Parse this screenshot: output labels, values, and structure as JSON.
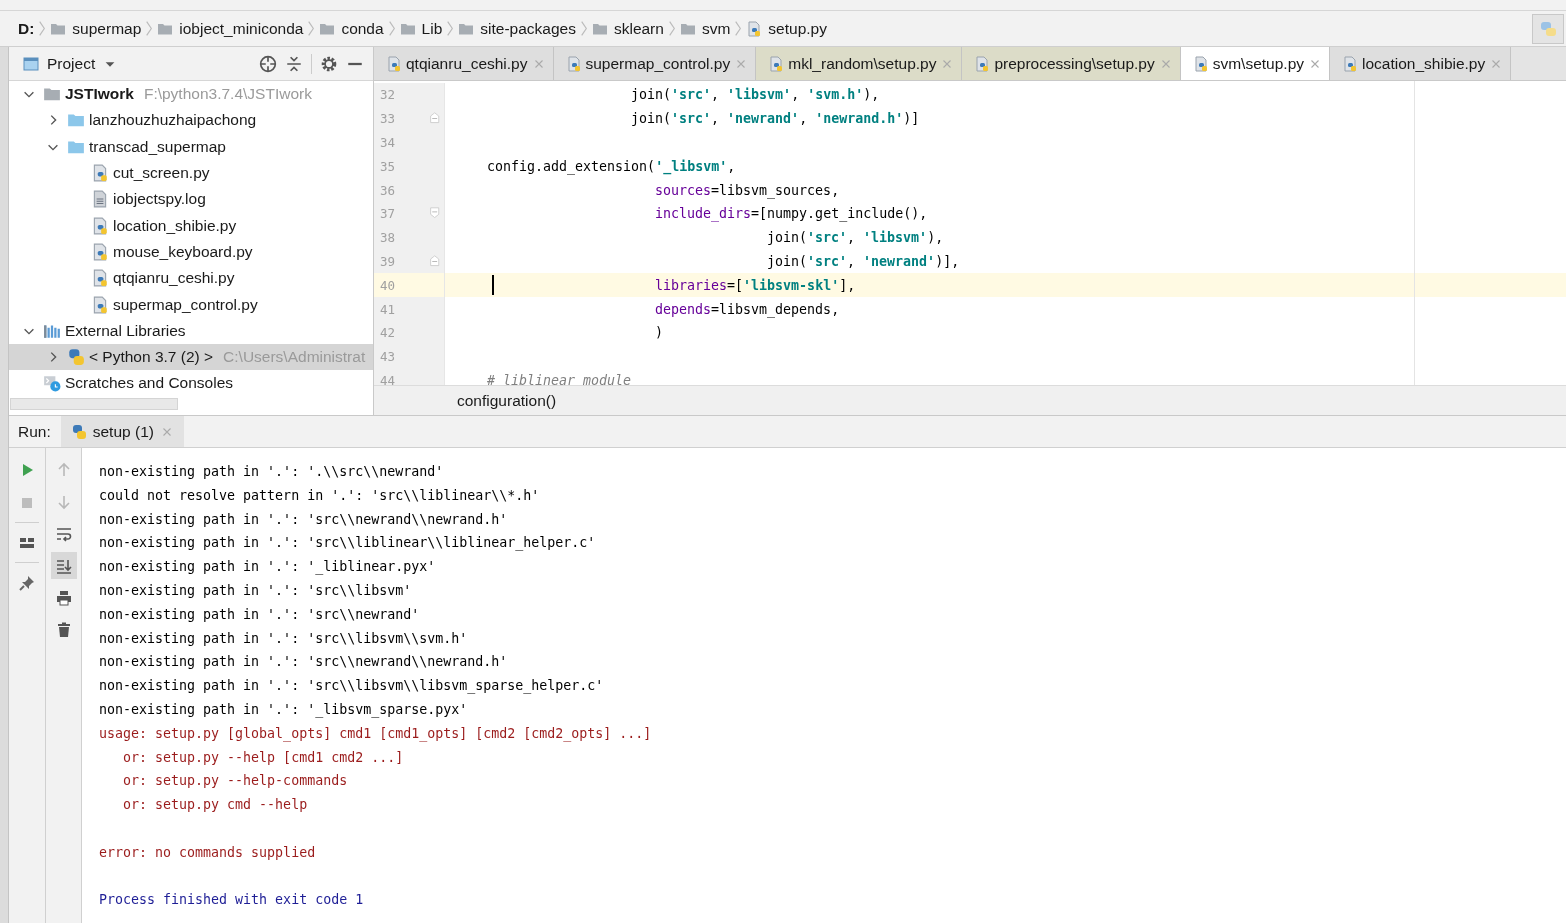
{
  "breadcrumbs": [
    {
      "label": "D:",
      "kind": "drive"
    },
    {
      "label": "supermap",
      "kind": "folder"
    },
    {
      "label": "iobject_miniconda",
      "kind": "folder"
    },
    {
      "label": "conda",
      "kind": "folder"
    },
    {
      "label": "Lib",
      "kind": "folder"
    },
    {
      "label": "site-packages",
      "kind": "folder"
    },
    {
      "label": "sklearn",
      "kind": "folder"
    },
    {
      "label": "svm",
      "kind": "folder"
    },
    {
      "label": "setup.py",
      "kind": "python"
    }
  ],
  "project": {
    "title": "Project",
    "tree": [
      {
        "label": "JSTIwork",
        "path": "F:\\python3.7.4\\JSTIwork",
        "kind": "module",
        "expanded": true,
        "selected": false,
        "children": [
          {
            "label": "lanzhouzhuzhaipachong",
            "kind": "folder",
            "expanded": false,
            "selected": false
          },
          {
            "label": "transcad_supermap",
            "kind": "folder",
            "expanded": true,
            "selected": false,
            "children": [
              {
                "label": "cut_screen.py",
                "kind": "python",
                "selected": false
              },
              {
                "label": "iobjectspy.log",
                "kind": "log",
                "selected": false
              },
              {
                "label": "location_shibie.py",
                "kind": "python",
                "selected": false
              },
              {
                "label": "mouse_keyboard.py",
                "kind": "python",
                "selected": false
              },
              {
                "label": "qtqianru_ceshi.py",
                "kind": "python",
                "selected": false
              },
              {
                "label": "supermap_control.py",
                "kind": "python",
                "selected": false
              }
            ]
          }
        ]
      },
      {
        "label": "External Libraries",
        "kind": "library",
        "expanded": true,
        "selected": false,
        "children": [
          {
            "label": "< Python 3.7 (2) >",
            "path": "C:\\Users\\Administrat",
            "kind": "sdk",
            "expanded": false,
            "selected": true
          }
        ]
      },
      {
        "label": "Scratches and Consoles",
        "kind": "scratches",
        "selected": false
      }
    ]
  },
  "editor_tabs": [
    {
      "label": "qtqianru_ceshi.py",
      "selected": false
    },
    {
      "label": "supermap_control.py",
      "selected": false
    },
    {
      "label": "mkl_random\\setup.py",
      "selected": false
    },
    {
      "label": "preprocessing\\setup.py",
      "selected": false
    },
    {
      "label": "svm\\setup.py",
      "selected": true
    },
    {
      "label": "location_shibie.py",
      "selected": false
    }
  ],
  "code_lines": [
    {
      "number": "32",
      "current": false,
      "tokens": [
        {
          "kind": "plain",
          "text": "                      join("
        },
        {
          "kind": "string",
          "text": "'src'"
        },
        {
          "kind": "plain",
          "text": ", "
        },
        {
          "kind": "string",
          "text": "'libsvm'"
        },
        {
          "kind": "plain",
          "text": ", "
        },
        {
          "kind": "string",
          "text": "'svm.h'"
        },
        {
          "kind": "plain",
          "text": "),"
        }
      ]
    },
    {
      "number": "33",
      "current": false,
      "fold_end": true,
      "tokens": [
        {
          "kind": "plain",
          "text": "                      join("
        },
        {
          "kind": "string",
          "text": "'src'"
        },
        {
          "kind": "plain",
          "text": ", "
        },
        {
          "kind": "string",
          "text": "'newrand'"
        },
        {
          "kind": "plain",
          "text": ", "
        },
        {
          "kind": "string",
          "text": "'newrand.h'"
        },
        {
          "kind": "plain",
          "text": ")]"
        }
      ]
    },
    {
      "number": "34",
      "current": false
    },
    {
      "number": "35",
      "current": false,
      "tokens": [
        {
          "kind": "plain",
          "text": "    config.add_extension("
        },
        {
          "kind": "string",
          "text": "'_libsvm'"
        },
        {
          "kind": "plain",
          "text": ","
        }
      ]
    },
    {
      "number": "36",
      "current": false,
      "tokens": [
        {
          "kind": "param",
          "text": "                         sources"
        },
        {
          "kind": "plain",
          "text": "=libsvm_sources,"
        }
      ]
    },
    {
      "number": "37",
      "current": false,
      "fold_start": true,
      "tokens": [
        {
          "kind": "param",
          "text": "                         include_dirs"
        },
        {
          "kind": "plain",
          "text": "=[numpy.get_include(),"
        }
      ]
    },
    {
      "number": "38",
      "current": false,
      "tokens": [
        {
          "kind": "plain",
          "text": "                                       join("
        },
        {
          "kind": "string",
          "text": "'src'"
        },
        {
          "kind": "plain",
          "text": ", "
        },
        {
          "kind": "string",
          "text": "'libsvm'"
        },
        {
          "kind": "plain",
          "text": "),"
        }
      ]
    },
    {
      "number": "39",
      "current": false,
      "fold_end": true,
      "tokens": [
        {
          "kind": "plain",
          "text": "                                       join("
        },
        {
          "kind": "string",
          "text": "'src'"
        },
        {
          "kind": "plain",
          "text": ", "
        },
        {
          "kind": "string",
          "text": "'newrand'"
        },
        {
          "kind": "plain",
          "text": ")],"
        }
      ]
    },
    {
      "number": "40",
      "current": true,
      "tokens": [
        {
          "kind": "param",
          "text": "                         libraries"
        },
        {
          "kind": "plain",
          "text": "=["
        },
        {
          "kind": "string",
          "text": "'libsvm-skl'"
        },
        {
          "kind": "plain",
          "text": "],"
        }
      ]
    },
    {
      "number": "41",
      "current": false,
      "tokens": [
        {
          "kind": "param",
          "text": "                         depends"
        },
        {
          "kind": "plain",
          "text": "=libsvm_depends,"
        }
      ]
    },
    {
      "number": "42",
      "current": false,
      "tokens": [
        {
          "kind": "plain",
          "text": "                         )"
        }
      ]
    },
    {
      "number": "43",
      "current": false
    },
    {
      "number": "44",
      "current": false,
      "tokens": [
        {
          "kind": "comment",
          "text": "    # liblinear module"
        }
      ]
    }
  ],
  "editor_breadcrumb": "configuration()",
  "run": {
    "label": "Run:",
    "tab": "setup (1)",
    "toolbar": [
      {
        "kind": "run"
      },
      {
        "kind": "stop"
      },
      {
        "kind": "layout"
      },
      {
        "kind": "pin"
      }
    ],
    "toolbar2": [
      {
        "kind": "up",
        "selected": false
      },
      {
        "kind": "down",
        "selected": false
      },
      {
        "kind": "wrap",
        "selected": false
      },
      {
        "kind": "scroll-end",
        "selected": true
      },
      {
        "kind": "print",
        "selected": false
      },
      {
        "kind": "trash",
        "selected": false
      }
    ],
    "lines": [
      {
        "kind": "output",
        "text": "non-existing path in '.': '.\\\\src\\\\newrand'"
      },
      {
        "kind": "output",
        "text": "could not resolve pattern in '.': 'src\\\\liblinear\\\\*.h'"
      },
      {
        "kind": "output",
        "text": "non-existing path in '.': 'src\\\\newrand\\\\newrand.h'"
      },
      {
        "kind": "output",
        "text": "non-existing path in '.': 'src\\\\liblinear\\\\liblinear_helper.c'"
      },
      {
        "kind": "output",
        "text": "non-existing path in '.': '_liblinear.pyx'"
      },
      {
        "kind": "output",
        "text": "non-existing path in '.': 'src\\\\libsvm'"
      },
      {
        "kind": "output",
        "text": "non-existing path in '.': 'src\\\\newrand'"
      },
      {
        "kind": "output",
        "text": "non-existing path in '.': 'src\\\\libsvm\\\\svm.h'"
      },
      {
        "kind": "output",
        "text": "non-existing path in '.': 'src\\\\newrand\\\\newrand.h'"
      },
      {
        "kind": "output",
        "text": "non-existing path in '.': 'src\\\\libsvm\\\\libsvm_sparse_helper.c'"
      },
      {
        "kind": "output",
        "text": "non-existing path in '.': '_libsvm_sparse.pyx'"
      },
      {
        "kind": "error",
        "text": "usage: setup.py [global_opts] cmd1 [cmd1_opts] [cmd2 [cmd2_opts] ...]"
      },
      {
        "kind": "error",
        "text": "   or: setup.py --help [cmd1 cmd2 ...]"
      },
      {
        "kind": "error",
        "text": "   or: setup.py --help-commands"
      },
      {
        "kind": "error",
        "text": "   or: setup.py cmd --help"
      },
      {
        "kind": "error",
        "text": "error: no commands supplied",
        "blank_before": true
      },
      {
        "kind": "system",
        "text": "Process finished with exit code 1",
        "blank_before": true
      }
    ]
  }
}
